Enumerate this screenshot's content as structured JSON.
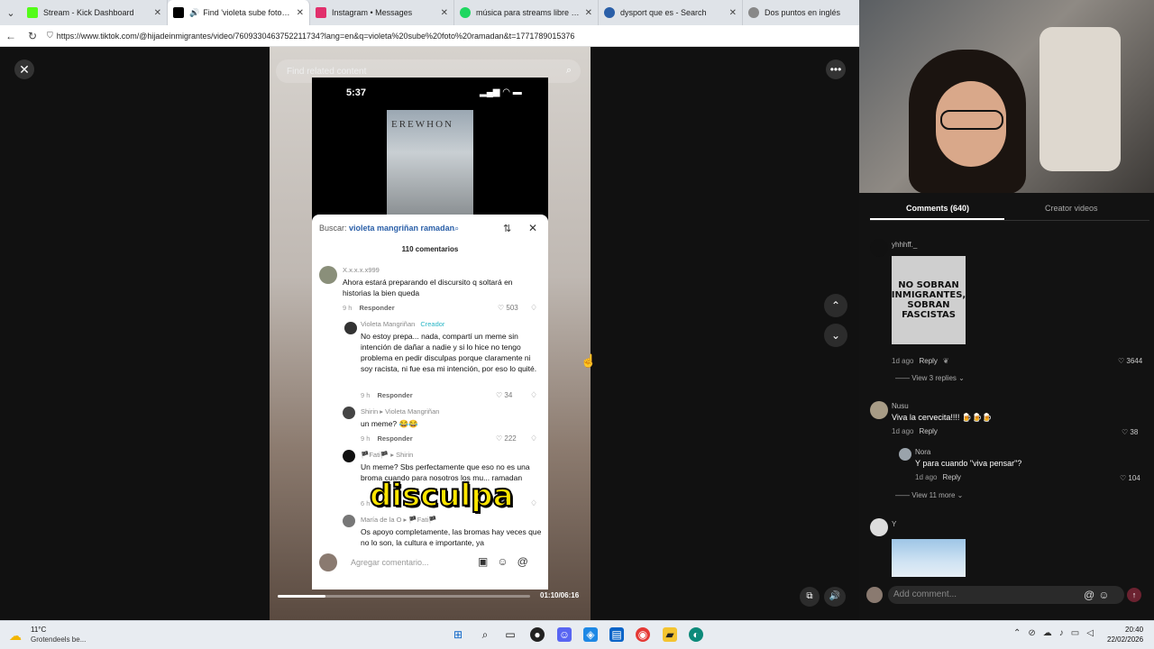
{
  "browser": {
    "tabs": [
      {
        "label": "Stream - Kick Dashboard",
        "color": "#53fc18"
      },
      {
        "label": "Find 'violeta sube foto ramad...",
        "color": "#000000",
        "active": true
      },
      {
        "label": "Instagram • Messages",
        "color": "#e1306c"
      },
      {
        "label": "música para streams libre de copy",
        "color": "#1ed760"
      },
      {
        "label": "dysport que es - Search",
        "color": "#2a5fa8"
      },
      {
        "label": "Dos puntos en inglés",
        "color": "#888888"
      }
    ],
    "url": "https://www.tiktok.com/@hijadeinmigrantes/video/7609330463752211734?lang=en&q=violeta%20sube%20foto%20ramadan&t=1771789015376"
  },
  "viewer": {
    "search_placeholder": "Find related content",
    "progress_time": "01:10/06:16",
    "progress_fraction": 0.19,
    "caption": "disculpa"
  },
  "phone": {
    "time": "5:37",
    "storefront": "EREWHON",
    "sheet": {
      "search_prefix": "Buscar:",
      "search_query": "violeta mangriñan ramadan",
      "count": "110 comentarios",
      "comments": [
        {
          "user": "X.x.x.x.x999",
          "text": "Ahora estará preparando el discursito q soltará en historias la bien queda",
          "time": "9 h",
          "reply": "Responder",
          "likes": "503"
        },
        {
          "user": "Violeta Mangriñan",
          "creator": "Creador",
          "text": "No estoy prepa... nada, compartí un meme sin intención de dañar a nadie y si lo hice no tengo problema en pedir disculpas porque claramente ni soy racista, ni fue esa mi intención, por eso lo quité.",
          "time": "9 h",
          "reply": "Responder",
          "likes": "34"
        },
        {
          "user": "Shirin ▸ Violeta Mangriñan",
          "text": "un meme? 😂😂",
          "time": "9 h",
          "reply": "Responder",
          "likes": "222"
        },
        {
          "user": "🏴Fati🏴 ▸ Shirin",
          "text": "Un meme? Sbs perfectamente que eso no es una broma cuando para nosotros los mu... ramadan",
          "time": "6 h",
          "reply": "",
          "likes": "15"
        },
        {
          "user": "María de la O ▸ 🏴Fati🏴",
          "text": "Os apoyo completamente, las bromas hay veces que no lo son, la cultura e importante, ya",
          "time": "",
          "reply": "",
          "likes": ""
        }
      ],
      "add_comment_placeholder": "Agregar comentario..."
    }
  },
  "side": {
    "tab_comments": "Comments (640)",
    "tab_creator": "Creator videos",
    "poster_lines": [
      "NO SOBRAN",
      "INMIGRANTES,",
      "SOBRAN",
      "FASCISTAS"
    ],
    "comments": [
      {
        "user": "yhhhff._",
        "time": "1d ago",
        "reply": "Reply",
        "likes": "3644",
        "view_replies": "View 3 replies"
      },
      {
        "user": "Nusu",
        "text": "Viva la cervecita!!!! 🍺🍺🍺",
        "time": "1d ago",
        "reply": "Reply",
        "likes": "38"
      },
      {
        "user": "Nora",
        "text": "Y para cuando \"viva pensar\"?",
        "time": "1d ago",
        "reply": "Reply",
        "likes": "104",
        "view_replies": "View 11 more"
      },
      {
        "user": "Y"
      }
    ],
    "add_comment": "Add comment..."
  },
  "taskbar": {
    "temp": "11°C",
    "weather": "Grotendeels be...",
    "time": "20:40",
    "date": "22/02/2026"
  }
}
